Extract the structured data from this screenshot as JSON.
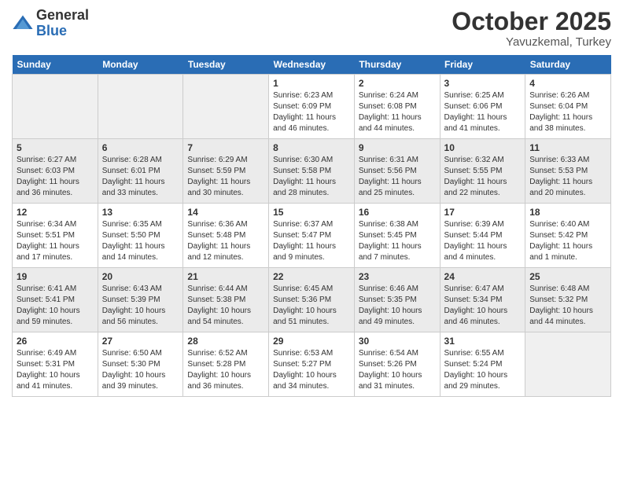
{
  "logo": {
    "general": "General",
    "blue": "Blue"
  },
  "title": "October 2025",
  "location": "Yavuzkemal, Turkey",
  "weekdays": [
    "Sunday",
    "Monday",
    "Tuesday",
    "Wednesday",
    "Thursday",
    "Friday",
    "Saturday"
  ],
  "rows": [
    {
      "cells": [
        {
          "empty": true
        },
        {
          "empty": true
        },
        {
          "empty": true
        },
        {
          "day": "1",
          "sunrise": "6:23 AM",
          "sunset": "6:09 PM",
          "daylight": "11 hours and 46 minutes."
        },
        {
          "day": "2",
          "sunrise": "6:24 AM",
          "sunset": "6:08 PM",
          "daylight": "11 hours and 44 minutes."
        },
        {
          "day": "3",
          "sunrise": "6:25 AM",
          "sunset": "6:06 PM",
          "daylight": "11 hours and 41 minutes."
        },
        {
          "day": "4",
          "sunrise": "6:26 AM",
          "sunset": "6:04 PM",
          "daylight": "11 hours and 38 minutes."
        }
      ]
    },
    {
      "cells": [
        {
          "day": "5",
          "sunrise": "6:27 AM",
          "sunset": "6:03 PM",
          "daylight": "11 hours and 36 minutes."
        },
        {
          "day": "6",
          "sunrise": "6:28 AM",
          "sunset": "6:01 PM",
          "daylight": "11 hours and 33 minutes."
        },
        {
          "day": "7",
          "sunrise": "6:29 AM",
          "sunset": "5:59 PM",
          "daylight": "11 hours and 30 minutes."
        },
        {
          "day": "8",
          "sunrise": "6:30 AM",
          "sunset": "5:58 PM",
          "daylight": "11 hours and 28 minutes."
        },
        {
          "day": "9",
          "sunrise": "6:31 AM",
          "sunset": "5:56 PM",
          "daylight": "11 hours and 25 minutes."
        },
        {
          "day": "10",
          "sunrise": "6:32 AM",
          "sunset": "5:55 PM",
          "daylight": "11 hours and 22 minutes."
        },
        {
          "day": "11",
          "sunrise": "6:33 AM",
          "sunset": "5:53 PM",
          "daylight": "11 hours and 20 minutes."
        }
      ]
    },
    {
      "cells": [
        {
          "day": "12",
          "sunrise": "6:34 AM",
          "sunset": "5:51 PM",
          "daylight": "11 hours and 17 minutes."
        },
        {
          "day": "13",
          "sunrise": "6:35 AM",
          "sunset": "5:50 PM",
          "daylight": "11 hours and 14 minutes."
        },
        {
          "day": "14",
          "sunrise": "6:36 AM",
          "sunset": "5:48 PM",
          "daylight": "11 hours and 12 minutes."
        },
        {
          "day": "15",
          "sunrise": "6:37 AM",
          "sunset": "5:47 PM",
          "daylight": "11 hours and 9 minutes."
        },
        {
          "day": "16",
          "sunrise": "6:38 AM",
          "sunset": "5:45 PM",
          "daylight": "11 hours and 7 minutes."
        },
        {
          "day": "17",
          "sunrise": "6:39 AM",
          "sunset": "5:44 PM",
          "daylight": "11 hours and 4 minutes."
        },
        {
          "day": "18",
          "sunrise": "6:40 AM",
          "sunset": "5:42 PM",
          "daylight": "11 hours and 1 minute."
        }
      ]
    },
    {
      "cells": [
        {
          "day": "19",
          "sunrise": "6:41 AM",
          "sunset": "5:41 PM",
          "daylight": "10 hours and 59 minutes."
        },
        {
          "day": "20",
          "sunrise": "6:43 AM",
          "sunset": "5:39 PM",
          "daylight": "10 hours and 56 minutes."
        },
        {
          "day": "21",
          "sunrise": "6:44 AM",
          "sunset": "5:38 PM",
          "daylight": "10 hours and 54 minutes."
        },
        {
          "day": "22",
          "sunrise": "6:45 AM",
          "sunset": "5:36 PM",
          "daylight": "10 hours and 51 minutes."
        },
        {
          "day": "23",
          "sunrise": "6:46 AM",
          "sunset": "5:35 PM",
          "daylight": "10 hours and 49 minutes."
        },
        {
          "day": "24",
          "sunrise": "6:47 AM",
          "sunset": "5:34 PM",
          "daylight": "10 hours and 46 minutes."
        },
        {
          "day": "25",
          "sunrise": "6:48 AM",
          "sunset": "5:32 PM",
          "daylight": "10 hours and 44 minutes."
        }
      ]
    },
    {
      "cells": [
        {
          "day": "26",
          "sunrise": "6:49 AM",
          "sunset": "5:31 PM",
          "daylight": "10 hours and 41 minutes."
        },
        {
          "day": "27",
          "sunrise": "6:50 AM",
          "sunset": "5:30 PM",
          "daylight": "10 hours and 39 minutes."
        },
        {
          "day": "28",
          "sunrise": "6:52 AM",
          "sunset": "5:28 PM",
          "daylight": "10 hours and 36 minutes."
        },
        {
          "day": "29",
          "sunrise": "6:53 AM",
          "sunset": "5:27 PM",
          "daylight": "10 hours and 34 minutes."
        },
        {
          "day": "30",
          "sunrise": "6:54 AM",
          "sunset": "5:26 PM",
          "daylight": "10 hours and 31 minutes."
        },
        {
          "day": "31",
          "sunrise": "6:55 AM",
          "sunset": "5:24 PM",
          "daylight": "10 hours and 29 minutes."
        },
        {
          "empty": true
        }
      ]
    }
  ]
}
